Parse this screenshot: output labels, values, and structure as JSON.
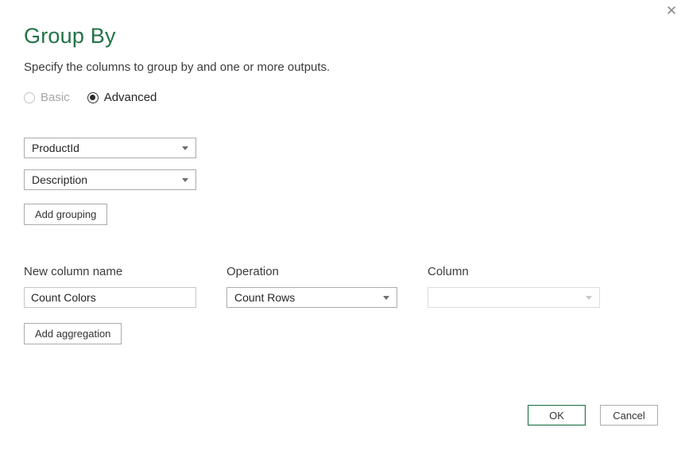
{
  "dialog": {
    "title": "Group By",
    "subtitle": "Specify the columns to group by and one or more outputs.",
    "close_glyph": "✕"
  },
  "mode": {
    "basic_label": "Basic",
    "basic_enabled": false,
    "advanced_label": "Advanced",
    "advanced_selected": true
  },
  "grouping": {
    "dropdowns": [
      {
        "value": "ProductId"
      },
      {
        "value": "Description"
      }
    ],
    "add_button_label": "Add grouping"
  },
  "aggregation": {
    "new_column_label": "New column name",
    "new_column_value": "Count Colors",
    "operation_label": "Operation",
    "operation_value": "Count Rows",
    "column_label": "Column",
    "column_value": "",
    "column_enabled": false,
    "add_button_label": "Add aggregation"
  },
  "footer": {
    "ok_label": "OK",
    "cancel_label": "Cancel"
  },
  "colors": {
    "accent_green": "#217346",
    "border_gray": "#ababab",
    "disabled_border": "#dcdcdc",
    "text_dark": "#333333",
    "disabled_text": "#a6a6a6"
  }
}
